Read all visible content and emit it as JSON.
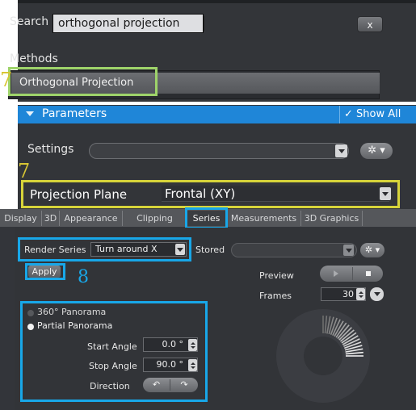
{
  "search": {
    "label": "Search",
    "value": "orthogonal projection",
    "clear_label": "x"
  },
  "methods": {
    "label": "Methods",
    "selected_item": "Orthogonal Projection"
  },
  "parameters": {
    "title": "Parameters",
    "show_all": "✓ Show All",
    "settings_label": "Settings",
    "settings_gear": "✲ ▾",
    "projection_plane_label": "Projection Plane",
    "projection_plane_value": "Frontal (XY)"
  },
  "step_markers": {
    "seven": "7",
    "eight": "8"
  },
  "tabs": [
    {
      "label": "Display"
    },
    {
      "label": "3D"
    },
    {
      "label": "Appearance"
    },
    {
      "label": "Clipping"
    },
    {
      "label": "Series"
    },
    {
      "label": "Measurements"
    },
    {
      "label": "3D Graphics"
    }
  ],
  "series": {
    "render_series_label": "Render Series",
    "render_series_value": "Turn around X",
    "stored_label": "Stored",
    "stored_gear": "✲ ▾",
    "apply_label": "Apply",
    "preview_label": "Preview",
    "frames_label": "Frames",
    "frames_value": "30",
    "panorama_360_label": "360° Panorama",
    "partial_panorama_label": "Partial Panorama",
    "selected_panorama": "Partial Panorama",
    "start_angle_label": "Start Angle",
    "start_angle_value": "0.0 °",
    "stop_angle_label": "Stop Angle",
    "stop_angle_value": "90.0 °",
    "direction_label": "Direction",
    "direction_ccw": "↶",
    "direction_cw": "↷"
  },
  "colors": {
    "highlight_green": "#9ed36a",
    "highlight_yellow": "#d7d43a",
    "highlight_blue": "#18a7e8",
    "header_blue": "#1f86d8",
    "step_yellow": "#d8c634"
  },
  "icons": {
    "gear": "gear-icon",
    "dropdown": "chevron-down-icon",
    "play": "play-icon",
    "stop": "stop-icon",
    "rotate_ccw": "rotate-ccw-icon",
    "rotate_cw": "rotate-cw-icon"
  }
}
